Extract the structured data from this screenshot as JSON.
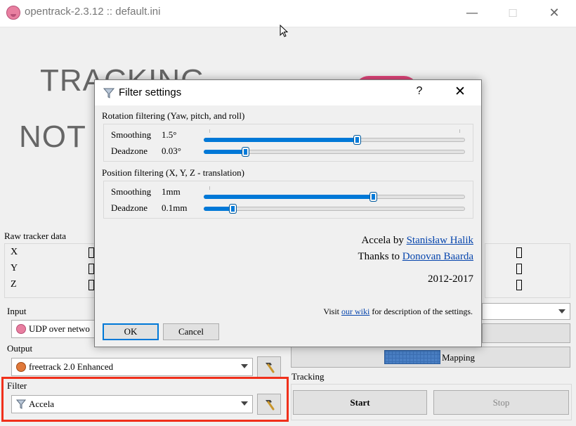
{
  "window": {
    "title": "opentrack-2.3.12 :: default.ini",
    "minimize": "—",
    "maximize": "☐",
    "close": "✕"
  },
  "status": {
    "line1": "TRACKING",
    "line2": "NOT S"
  },
  "raw_tracker": {
    "label": "Raw tracker data",
    "axes": [
      "X",
      "Y",
      "Z"
    ]
  },
  "input": {
    "label": "Input",
    "selected": "UDP over netwo"
  },
  "output": {
    "label": "Output",
    "selected": "freetrack 2.0 Enhanced"
  },
  "filter": {
    "label": "Filter",
    "selected": "Accela"
  },
  "mapping": {
    "label": "Mapping"
  },
  "tracking": {
    "label": "Tracking",
    "start": "Start",
    "stop": "Stop"
  },
  "colors": {
    "highlight": "#f0301b",
    "slider_accent": "#0078d7",
    "link": "#0645ad"
  },
  "dialog": {
    "title": "Filter settings",
    "help": "?",
    "close": "✕",
    "rotation": {
      "title": "Rotation filtering (Yaw, pitch, and roll)",
      "smoothing_label": "Smoothing",
      "smoothing_value": "1.5°",
      "smoothing_level": 0.59,
      "deadzone_label": "Deadzone",
      "deadzone_value": "0.03°",
      "deadzone_level": 0.16
    },
    "position": {
      "title": "Position filtering (X, Y, Z - translation)",
      "smoothing_label": "Smoothing",
      "smoothing_value": "1mm",
      "smoothing_level": 0.65,
      "deadzone_label": "Deadzone",
      "deadzone_value": "0.1mm",
      "deadzone_level": 0.11
    },
    "credits": {
      "author_prefix": "Accela by",
      "author": "Stanisław Halik",
      "thanks_prefix": "Thanks to",
      "thanks": "Donovan Baarda",
      "years": "2012-2017"
    },
    "visit": {
      "prefix": "Visit",
      "link": "our wiki",
      "suffix": "for description of the settings."
    },
    "ok": "OK",
    "cancel": "Cancel"
  }
}
